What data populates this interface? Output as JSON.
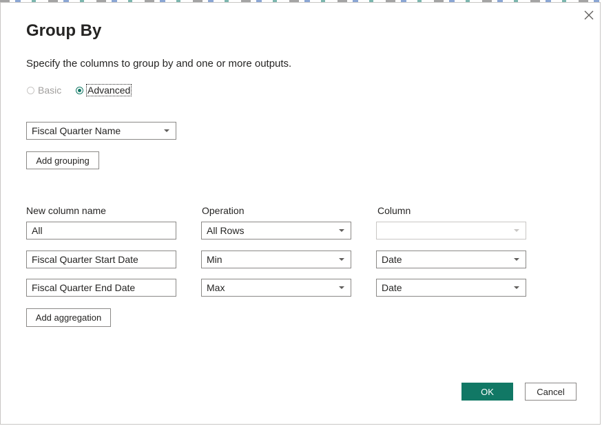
{
  "dialog": {
    "title": "Group By",
    "subtitle": "Specify the columns to group by and one or more outputs.",
    "close_icon": "close-icon"
  },
  "mode": {
    "basic_label": "Basic",
    "advanced_label": "Advanced",
    "selected": "Advanced"
  },
  "grouping": {
    "fields": [
      "Fiscal Quarter Name"
    ],
    "add_button": "Add grouping"
  },
  "aggregations": {
    "headers": {
      "new_column_name": "New column name",
      "operation": "Operation",
      "column": "Column"
    },
    "rows": [
      {
        "name": "All",
        "operation": "All Rows",
        "column": ""
      },
      {
        "name": "Fiscal Quarter Start Date",
        "operation": "Min",
        "column": "Date"
      },
      {
        "name": "Fiscal Quarter End Date",
        "operation": "Max",
        "column": "Date"
      }
    ],
    "add_button": "Add aggregation"
  },
  "footer": {
    "ok_label": "OK",
    "cancel_label": "Cancel"
  },
  "colors": {
    "accent": "#117865",
    "border": "#8a8886",
    "disabled": "#a19f9d"
  }
}
